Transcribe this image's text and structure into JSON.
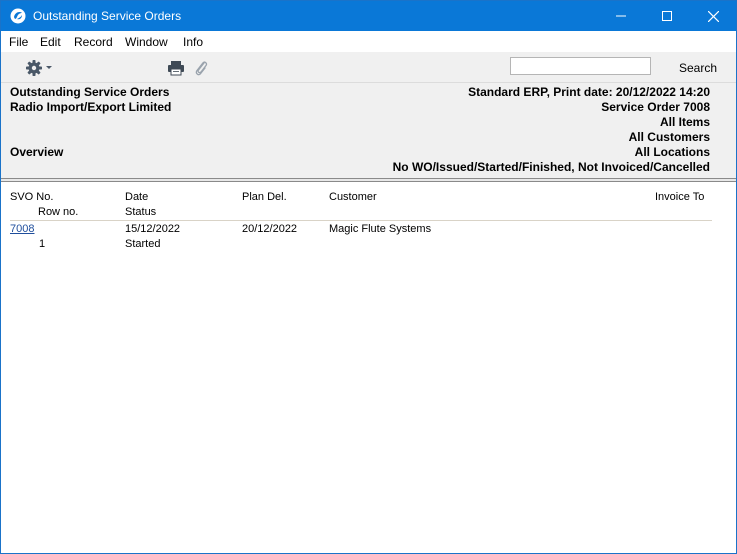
{
  "window": {
    "title": "Outstanding Service Orders"
  },
  "menu": [
    "File",
    "Edit",
    "Record",
    "Window",
    "Info"
  ],
  "toolbar": {
    "search_placeholder": "",
    "search_label": "Search"
  },
  "report_header": {
    "title": "Outstanding Service Orders",
    "company": "Radio Import/Export Limited",
    "section": "Overview",
    "right": [
      "Standard ERP, Print date: 20/12/2022 14:20",
      "Service Order 7008",
      "All Items",
      "All Customers",
      "All Locations",
      "No WO/Issued/Started/Finished, Not Invoiced/Cancelled"
    ]
  },
  "columns": {
    "svo_no": "SVO No.",
    "row_no": "Row no.",
    "date": "Date",
    "status": "Status",
    "plan_del": "Plan Del.",
    "customer": "Customer",
    "invoice_to": "Invoice To"
  },
  "rows": [
    {
      "svo_no": "7008",
      "date": "15/12/2022",
      "plan_del": "20/12/2022",
      "customer": "Magic Flute Systems",
      "invoice_to": "",
      "row_no": "1",
      "status": "Started"
    }
  ],
  "colors": {
    "titlebar": "#0a78d7",
    "header_bg": "#f0f0f0",
    "link": "#1f4e9c"
  }
}
